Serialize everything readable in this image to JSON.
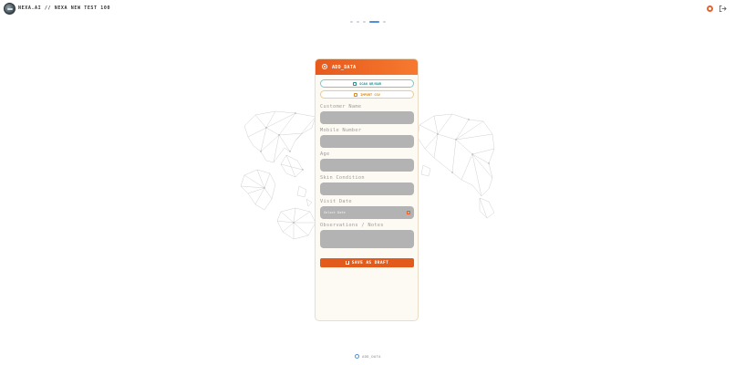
{
  "header": {
    "title": "NEXA.AI // NEXA NEW TEST 100",
    "logo_icon": "globe-logo-icon",
    "settings_icon": "settings-icon",
    "logout_icon": "logout-icon",
    "accent_color": "#e8602a"
  },
  "stepper": {
    "step_count": 5,
    "active_index": 3,
    "active_color": "#4f8fdc"
  },
  "form": {
    "title": "ADD_DATA",
    "header_icon": "target-icon",
    "scan_button": {
      "label": "SCAN QR/BAR",
      "icon": "qr-scan-icon"
    },
    "csv_button": {
      "label": "IMPORT CSV",
      "icon": "file-import-icon"
    },
    "fields": [
      {
        "label": "Customer Name",
        "value": "",
        "placeholder": ""
      },
      {
        "label": "Mobile Number",
        "value": "",
        "placeholder": ""
      },
      {
        "label": "Age",
        "value": "",
        "placeholder": ""
      },
      {
        "label": "Skin Condition",
        "value": "",
        "placeholder": ""
      },
      {
        "label": "Visit Date",
        "value": "",
        "placeholder": "Select Date",
        "icon": "calendar-icon"
      },
      {
        "label": "Observations / Notes",
        "value": "",
        "placeholder": ""
      }
    ],
    "save_button": {
      "label": "SAVE AS DRAFT",
      "icon": "download-icon"
    }
  },
  "footer": {
    "label": "ADD_DATA",
    "icon": "target-icon"
  }
}
